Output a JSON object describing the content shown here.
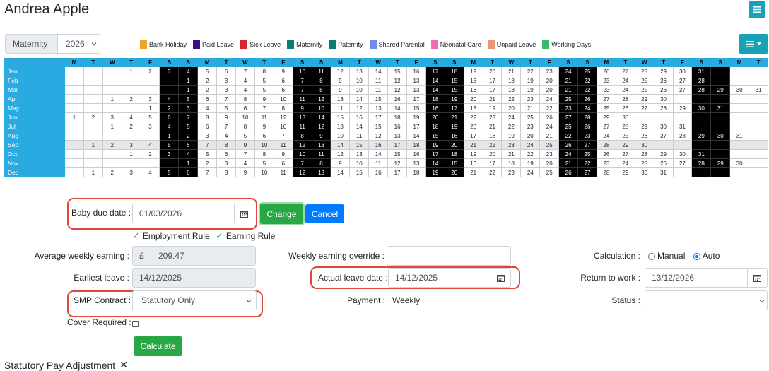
{
  "header": {
    "title": "Andrea Apple"
  },
  "filters": {
    "leave_type": "Maternity",
    "year": "2026"
  },
  "legend": [
    {
      "label": "Bank Holiday",
      "color": "#f0a02c"
    },
    {
      "label": "Paid Leave",
      "color": "#3c0b8c"
    },
    {
      "label": "Sick Leave",
      "color": "#d9232e"
    },
    {
      "label": "Maternity",
      "color": "#0c7c72"
    },
    {
      "label": "Paternity",
      "color": "#0c7c72"
    },
    {
      "label": "Shared Parental",
      "color": "#6f8de8"
    },
    {
      "label": "Neonatal Care",
      "color": "#f469b7"
    },
    {
      "label": "Unpaid Leave",
      "color": "#ea957a"
    },
    {
      "label": "Working Days",
      "color": "#3cba6b"
    }
  ],
  "calendar": {
    "weekday_headers": [
      "M",
      "T",
      "W",
      "T",
      "F",
      "S",
      "S",
      "M",
      "T",
      "W",
      "T",
      "F",
      "S",
      "S",
      "M",
      "T",
      "W",
      "T",
      "F",
      "S",
      "S",
      "M",
      "T",
      "W",
      "T",
      "F",
      "S",
      "S",
      "M",
      "T",
      "W",
      "T",
      "F",
      "S",
      "S",
      "M",
      "T"
    ],
    "months": [
      {
        "name": "Jan",
        "offset": 3,
        "days": 31
      },
      {
        "name": "Feb",
        "offset": 6,
        "days": 28
      },
      {
        "name": "Mar",
        "offset": 6,
        "days": 31
      },
      {
        "name": "Apr",
        "offset": 2,
        "days": 30
      },
      {
        "name": "May",
        "offset": 4,
        "days": 31
      },
      {
        "name": "Jun",
        "offset": 0,
        "days": 30
      },
      {
        "name": "Jul",
        "offset": 2,
        "days": 31
      },
      {
        "name": "Aug",
        "offset": 5,
        "days": 31
      },
      {
        "name": "Sep",
        "offset": 1,
        "days": 30
      },
      {
        "name": "Oct",
        "offset": 3,
        "days": 31
      },
      {
        "name": "Nov",
        "offset": 6,
        "days": 30
      },
      {
        "name": "Dec",
        "offset": 1,
        "days": 31
      }
    ],
    "selected_month": "Sep"
  },
  "form": {
    "baby_due_date_label": "Baby due date :",
    "baby_due_date_value": "01/03/2026",
    "change_label": "Change",
    "cancel_label": "Cancel",
    "employment_rule": "Employment Rule",
    "earning_rule": "Earning Rule",
    "avg_weekly_label": "Average weekly earning :",
    "currency": "£",
    "avg_weekly_value": "209.47",
    "weekly_override_label": "Weekly earning override :",
    "weekly_override_value": "",
    "calculation_label": "Calculation :",
    "calc_manual": "Manual",
    "calc_auto": "Auto",
    "earliest_leave_label": "Earliest leave :",
    "earliest_leave_value": "14/12/2025",
    "actual_leave_label": "Actual leave date :",
    "actual_leave_value": "14/12/2025",
    "return_label": "Return to work :",
    "return_value": "13/12/2026",
    "smp_label": "SMP Contract :",
    "smp_value": "Statutory Only",
    "payment_label": "Payment :",
    "payment_value": "Weekly",
    "status_label": "Status :",
    "status_value": "",
    "cover_label": "Cover Required :",
    "calculate_label": "Calculate",
    "adjustment_label": "Statutory Pay Adjustment"
  }
}
